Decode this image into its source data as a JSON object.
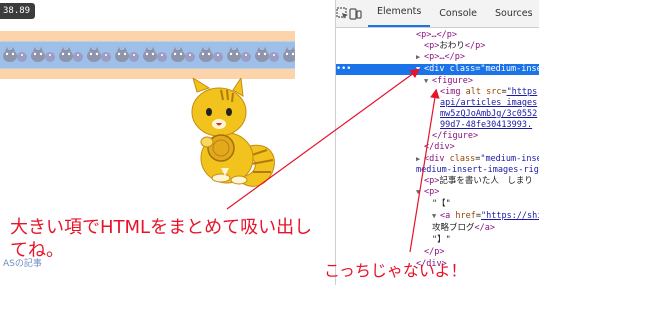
{
  "page": {
    "dimension_badge": "38.89",
    "author_link": "ASの記事",
    "annotation_left": "大きい項でHTMLをまとめて吸い出してね。",
    "annotation_right": "こっちじゃないよ！"
  },
  "devtools": {
    "tabs": [
      {
        "label": "Elements",
        "active": true
      },
      {
        "label": "Console",
        "active": false
      },
      {
        "label": "Sources",
        "active": false
      }
    ],
    "toolbar_icons": [
      "inspect-icon",
      "device-toolbar-icon"
    ],
    "tree": {
      "r0": "<p>…</p>",
      "r1a": "<p>",
      "r1b": "おわり",
      "r1c": "</p>",
      "r2": "<p>…</p>",
      "r3_dots": "•••",
      "r3_tag": "<div",
      "r3_attr": "class",
      "r3_val": "\"medium-inse",
      "r4": "<figure>",
      "r5_tag": "<img",
      "r5_attr": "alt src",
      "r5_val": "\"https",
      "r6": "api/articles_images",
      "r7": "mw5zQJoAmbJg/3c0552",
      "r8": "99d7-48fe30413993.",
      "r9": "</figure>",
      "r10": "</div>",
      "r11_tag": "<div",
      "r11_attr": "class",
      "r11_val": "\"medium-inse",
      "r12": "medium-insert-images-rig",
      "r13a": "<p>",
      "r13b": "記事を書いた人　しまり",
      "r14": "<p>",
      "r15": "\"【\"",
      "r16_tag": "<a",
      "r16_attr": "href",
      "r16_val": "\"https://shin",
      "r17a": "攻略ブログ",
      "r17b": "</a>",
      "r18": "\"】\"",
      "r19": "</p>",
      "r20": "</div>"
    }
  },
  "colors": {
    "annotation_red": "#e8132a",
    "selection_blue": "#1a73e8",
    "band_orange": "#fdd3a9",
    "strip_blue": "#9ebfe7",
    "mascot_yellow": "#f2c21d"
  }
}
